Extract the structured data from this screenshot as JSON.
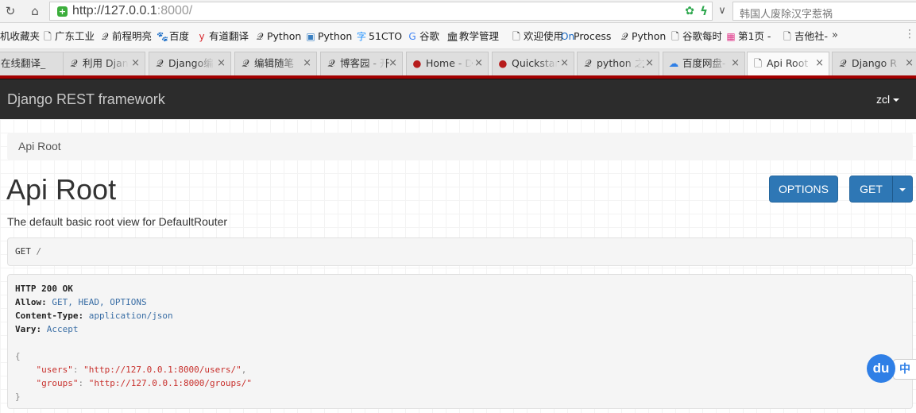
{
  "browser": {
    "url_host": "http://127.0.0.1",
    "url_port": ":8000/",
    "search_placeholder": "韩国人废除汉字惹祸",
    "bookmarks": [
      {
        "label": "机收藏夹",
        "icon": "folder-icon",
        "glyph": ""
      },
      {
        "label": "广东工业",
        "icon": "page-icon",
        "glyph": "🗋"
      },
      {
        "label": "前程明亮",
        "icon": "django-icon",
        "glyph": "𝒬"
      },
      {
        "label": "百度",
        "icon": "baidu-paw-icon",
        "glyph": "🐾"
      },
      {
        "label": "有道翻译",
        "icon": "youdao-icon",
        "glyph": "y"
      },
      {
        "label": "Python",
        "icon": "django-icon",
        "glyph": "𝒬"
      },
      {
        "label": "Python",
        "icon": "python-icon",
        "glyph": "▣"
      },
      {
        "label": "51CTO",
        "icon": "51cto-icon",
        "glyph": "字"
      },
      {
        "label": "谷歌",
        "icon": "google-icon",
        "glyph": "G"
      },
      {
        "label": "教学管理",
        "icon": "building-icon",
        "glyph": "🏛"
      },
      {
        "label": "欢迎使用",
        "icon": "page-icon",
        "glyph": "🗋"
      },
      {
        "label": "Process",
        "icon": "on-icon",
        "glyph": "On"
      },
      {
        "label": "Python",
        "icon": "django-icon",
        "glyph": "𝒬"
      },
      {
        "label": "谷歌每时",
        "icon": "page-icon",
        "glyph": "🗋"
      },
      {
        "label": "第1页 -",
        "icon": "pink-icon",
        "glyph": "▦"
      },
      {
        "label": "吉他社-",
        "icon": "page-icon",
        "glyph": "🗋"
      }
    ],
    "tabs": [
      {
        "label": "在线翻译_",
        "icon": "",
        "active": false
      },
      {
        "label": "利用 Djan",
        "icon": "django-icon",
        "active": false
      },
      {
        "label": "Django编",
        "icon": "django-icon",
        "active": false
      },
      {
        "label": "编辑随笔",
        "icon": "django-icon",
        "active": false
      },
      {
        "label": "博客园 - 开",
        "icon": "django-icon",
        "active": false
      },
      {
        "label": "Home - D",
        "icon": "red-dot-icon",
        "active": false
      },
      {
        "label": "Quickstar",
        "icon": "red-dot-icon",
        "active": false
      },
      {
        "label": "python 之",
        "icon": "django-icon",
        "active": false
      },
      {
        "label": "百度网盘-",
        "icon": "baidu-cloud-icon",
        "active": false
      },
      {
        "label": "Api Root",
        "icon": "page-icon",
        "active": true
      },
      {
        "label": "Django R",
        "icon": "django-icon",
        "active": false
      }
    ]
  },
  "navbar": {
    "brand": "Django REST framework",
    "user": "zcl"
  },
  "page": {
    "breadcrumb": "Api Root",
    "title": "Api Root",
    "description": "The default basic root view for DefaultRouter",
    "options_label": "OPTIONS",
    "get_label": "GET",
    "request": {
      "method": "GET",
      "path": "/"
    },
    "response": {
      "status": "HTTP 200 OK",
      "allow_key": "Allow:",
      "allow_val": "GET, HEAD, OPTIONS",
      "ctype_key": "Content-Type:",
      "ctype_val": "application/json",
      "vary_key": "Vary:",
      "vary_val": "Accept",
      "open_brace": "{",
      "close_brace": "}",
      "users_key": "\"users\"",
      "users_val": "\"http://127.0.0.1:8000/users/\"",
      "groups_key": "\"groups\"",
      "groups_val": "\"http://127.0.0.1:8000/groups/\""
    }
  },
  "overlay": {
    "badge": "du",
    "lang": "中"
  }
}
